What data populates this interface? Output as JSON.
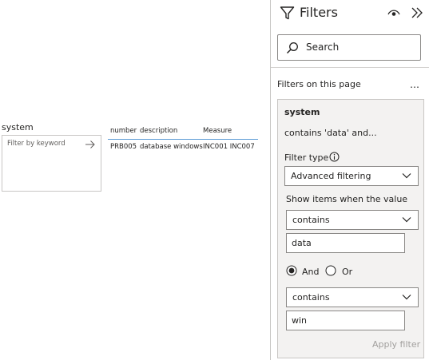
{
  "canvas": {
    "slicer": {
      "title": "system",
      "placeholder": "Filter by keyword"
    },
    "table": {
      "columns": [
        "number",
        "description",
        "Measure"
      ],
      "rows": [
        [
          "PRB005",
          "database windows",
          "INC001 INC007"
        ]
      ]
    }
  },
  "filter_pane": {
    "title": "Filters",
    "search_label": "Search",
    "section_label": "Filters on this page",
    "more_icon": "…",
    "card": {
      "field": "system",
      "summary": "contains 'data' and...",
      "filter_type_label": "Filter type",
      "filter_type_value": "Advanced filtering",
      "show_items_label": "Show items when the value",
      "condition1": {
        "operator": "contains",
        "value": "data"
      },
      "logic": {
        "and_label": "And",
        "or_label": "Or",
        "selected": "And"
      },
      "condition2": {
        "operator": "contains",
        "value": "win"
      },
      "apply_label": "Apply filter"
    }
  },
  "icons": {
    "filter": "filter-icon",
    "eye": "eye-icon",
    "collapse": "collapse-pane-icon",
    "search": "search-icon",
    "arrow": "arrow-right-icon",
    "info": "info-icon",
    "chevron": "chevron-down-icon"
  },
  "colors": {
    "accent_line": "#5b9bd5",
    "card_bg": "#f3f2f1",
    "border": "#8a8886",
    "disabled_text": "#a19f9d"
  }
}
